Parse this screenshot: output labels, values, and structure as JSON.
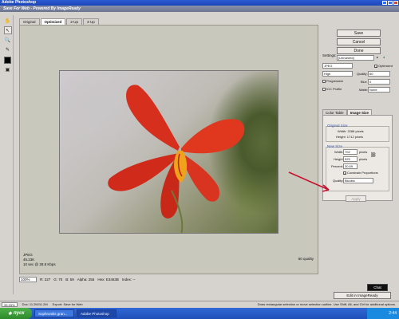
{
  "app": {
    "title": "Adobe Photoshop"
  },
  "dialog": {
    "title": "Save For Web - Powered By ImageReady"
  },
  "tabs": [
    {
      "label": "Original"
    },
    {
      "label": "Optimized"
    },
    {
      "label": "2-Up"
    },
    {
      "label": "4-Up"
    }
  ],
  "preview": {
    "info_line1": "JPEG",
    "info_line2": "45.23K",
    "info_line3": "10 sec @ 28.8 Kbps",
    "quality": "60 quality"
  },
  "statusbar": {
    "zoom": "100%",
    "r": "R: 227",
    "g": "G: 70",
    "b": "B: 59",
    "alpha": "Alpha: 255",
    "hex": "Hex: E3463B",
    "index": "Index: --"
  },
  "buttons": {
    "save": "Save",
    "cancel": "Cancel",
    "done": "Done"
  },
  "settings": {
    "label": "Settings:",
    "preset": "[Unnamed]",
    "format": "JPEG",
    "optimized_label": "Optimized",
    "quality_level": "High",
    "quality_label": "Quality:",
    "quality_value": "60",
    "progressive_label": "Progressive",
    "blur_label": "Blur:",
    "blur_value": "0",
    "icc_label": "ICC Profile",
    "matte_label": "Matte:",
    "matte_value": "None"
  },
  "subtabs": [
    {
      "label": "Color Table"
    },
    {
      "label": "Image Size"
    }
  ],
  "image_size": {
    "original_title": "Original Size",
    "orig_width": "Width: 2288 pixels",
    "orig_height": "Height: 1712 pixels",
    "new_title": "New Size",
    "width_label": "Width:",
    "width_value": "702",
    "height_label": "Height:",
    "height_value": "525",
    "pixels": "pixels",
    "percent_label": "Percent:",
    "percent_value": "30.69",
    "constrain_label": "Constrain Proportions",
    "quality_label": "Quality:",
    "quality_value": "Bicubic",
    "apply": "Apply"
  },
  "bottom": {
    "edit": "Edit in ImageReady",
    "chat": "Chat"
  },
  "ps_status": {
    "zoom": "33.33%",
    "doc": "Doc: 11.2M/11.2M",
    "export": "Export: Save for Web",
    "hint": "Draw rectangular selection or move selection outline. Use Shift, Alt, and Ctrl for additional options."
  },
  "taskbar": {
    "start": "пуск",
    "task1": "Sophronitis gran...",
    "task2": "Adobe Photoshop",
    "clock": "2:44"
  },
  "colors": {
    "accent_red": "#d62f1e",
    "arrow": "#c8102e"
  }
}
